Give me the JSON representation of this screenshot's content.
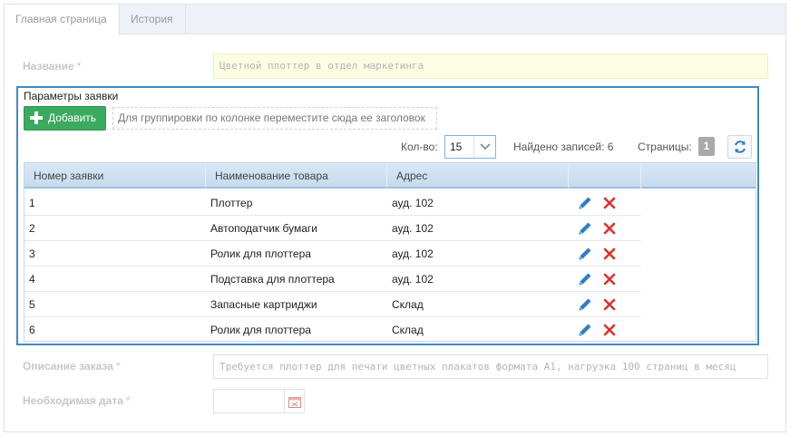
{
  "tabs": [
    {
      "label": "Главная страница"
    },
    {
      "label": "История"
    }
  ],
  "form": {
    "name_label": "Название",
    "name_value": "Цветной плоттер в отдел маркетинга",
    "description_label": "Описание заказа",
    "description_value": "Требуется плоттер для печати цветных плакатов формата А1, нагрузка 100 страниц в месяц",
    "date_label": "Необходимая дата",
    "date_value": "",
    "required_mark": "*"
  },
  "panel": {
    "title": "Параметры заявки",
    "add_label": "Добавить",
    "group_hint": "Для группировки по колонке переместите сюда ее заголовок",
    "qty_label": "Кол-во:",
    "qty_value": "15",
    "found_label": "Найдено записей: 6",
    "pages_label": "Страницы:",
    "page_number": "1"
  },
  "grid": {
    "columns": [
      "Номер заявки",
      "Наименование товара",
      "Адрес",
      "",
      ""
    ],
    "rows": [
      {
        "num": "1",
        "product": "Плоттер",
        "address": "ауд. 102"
      },
      {
        "num": "2",
        "product": "Автоподатчик бумаги",
        "address": "ауд. 102"
      },
      {
        "num": "3",
        "product": "Ролик для плоттера",
        "address": "ауд. 102"
      },
      {
        "num": "4",
        "product": "Подставка для плоттера",
        "address": "ауд. 102"
      },
      {
        "num": "5",
        "product": "Запасные картриджи",
        "address": "Склад"
      },
      {
        "num": "6",
        "product": "Ролик для плоттера",
        "address": "Склад"
      }
    ]
  },
  "colors": {
    "accent": "#3d8ac5",
    "add_button": "#3aaa5f",
    "edit_icon": "#2f7fc1",
    "delete_icon": "#d9322b"
  },
  "icons": {
    "add": "plus-icon",
    "dropdown": "chevron-down-icon",
    "refresh": "refresh-icon",
    "edit": "pencil-icon",
    "delete": "close-icon",
    "calendar": "calendar-icon"
  }
}
